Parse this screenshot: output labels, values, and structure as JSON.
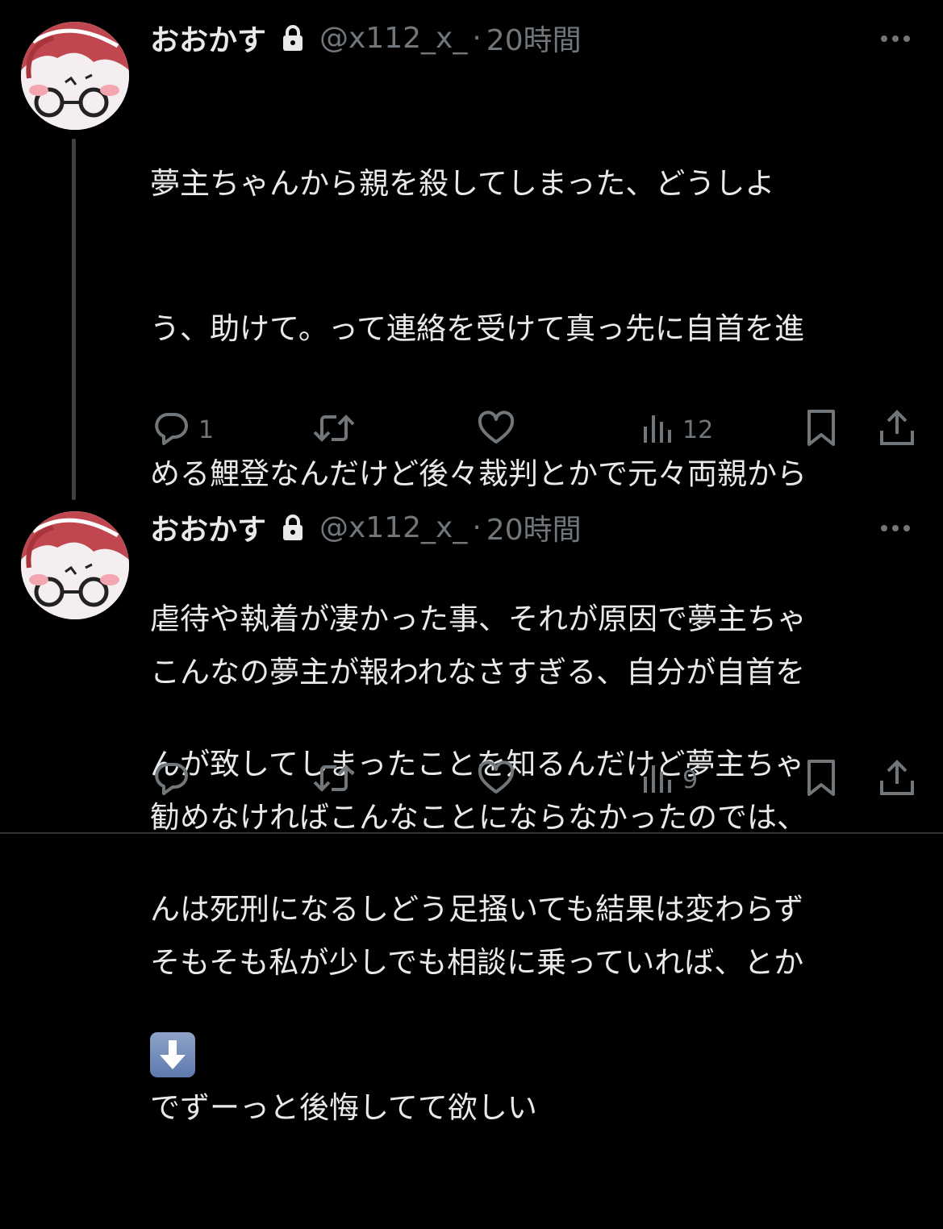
{
  "tweets": [
    {
      "display_name": "おおかす",
      "handle": "@x112_x_",
      "separator": "·",
      "time": "20時間",
      "lines": [
        "夢主ちゃんから親を殺してしまった、どうしよ",
        "う、助けて。って連絡を受けて真っ先に自首を進",
        "める鯉登なんだけど後々裁判とかで元々両親から",
        "虐待や執着が凄かった事、それが原因で夢主ちゃ",
        "んが致してしまったことを知るんだけど夢主ちゃ",
        "んは死刑になるしどう足掻いても結果は変わらず"
      ],
      "emoji": "down-arrow-emoji",
      "reply_count": "1",
      "retweet_count": "",
      "like_count": "",
      "view_count": "12"
    },
    {
      "display_name": "おおかす",
      "handle": "@x112_x_",
      "separator": "·",
      "time": "20時間",
      "lines": [
        "こんなの夢主が報われなさすぎる、自分が自首を",
        "勧めなければこんなことにならなかったのでは、",
        "そもそも私が少しでも相談に乗っていれば、とか",
        "でずーっと後悔してて欲しい"
      ],
      "reply_count": "",
      "retweet_count": "",
      "like_count": "",
      "view_count": "9"
    }
  ],
  "icons": {
    "lock": "lock-icon",
    "more": "more-icon",
    "reply": "reply-icon",
    "retweet": "retweet-icon",
    "like": "like-icon",
    "views": "views-icon",
    "bookmark": "bookmark-icon",
    "share": "share-icon"
  },
  "colors": {
    "background": "#000000",
    "primary_text": "#e7e9ea",
    "secondary_text": "#71767b",
    "thread_line": "#3e4144",
    "avatar_hair": "#c0474f"
  }
}
